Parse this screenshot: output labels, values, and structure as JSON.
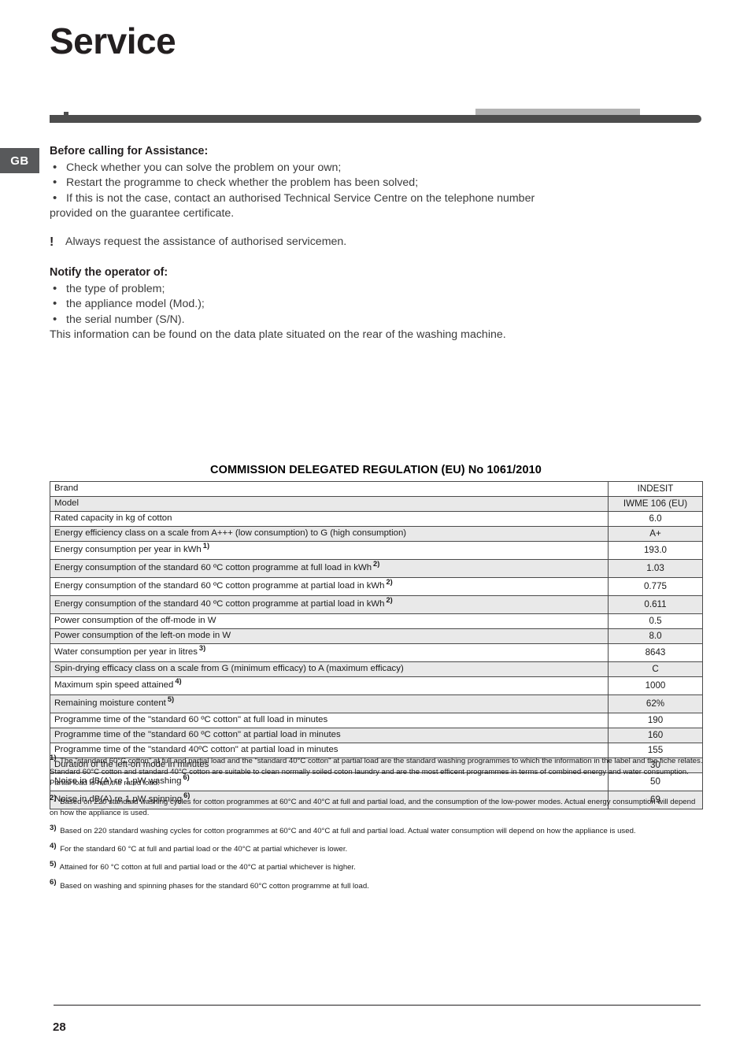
{
  "page": {
    "title": "Service",
    "language_tab": "GB",
    "page_number": "28"
  },
  "assistance": {
    "heading": "Before calling for Assistance:",
    "bullets": [
      "Check whether you can solve the problem on your own;",
      "Restart the programme to check whether the problem has been solved;",
      "If this is not the case, contact an authorised Technical Service Centre on the telephone number"
    ],
    "continuation": "provided on the guarantee certificate."
  },
  "warning": {
    "marker": "!",
    "text": "Always request the assistance of authorised servicemen."
  },
  "notify": {
    "heading": "Notify the operator of:",
    "bullets": [
      "the type of problem;",
      "the appliance model (Mod.);",
      "the serial number (S/N)."
    ],
    "closing": "This information can be found on the data plate situated on the rear of the washing machine."
  },
  "regulation_table": {
    "title": "COMMISSION DELEGATED REGULATION (EU) No 1061/2010",
    "rows": [
      {
        "label": "Brand",
        "footnote": "",
        "value": "INDESIT",
        "shade": false,
        "tall": false
      },
      {
        "label": "Model",
        "footnote": "",
        "value": "IWME 106 (EU)",
        "shade": true,
        "tall": false
      },
      {
        "label": "Rated capacity in kg of cotton",
        "footnote": "",
        "value": "6.0",
        "shade": false,
        "tall": false
      },
      {
        "label": "Energy efficiency class on a scale from A+++ (low consumption) to G (high consumption)",
        "footnote": "",
        "value": "A+",
        "shade": true,
        "tall": false
      },
      {
        "label": "Energy consumption per year in kWh",
        "footnote": "1)",
        "value": "193.0",
        "shade": false,
        "tall": true
      },
      {
        "label": "Energy consumption of the standard 60 ºC cotton programme at full load in kWh",
        "footnote": "2)",
        "value": "1.03",
        "shade": true,
        "tall": true
      },
      {
        "label": "Energy consumption of the standard 60 ºC cotton programme at partial load in kWh",
        "footnote": "2)",
        "value": "0.775",
        "shade": false,
        "tall": true
      },
      {
        "label": "Energy consumption of the standard 40 ºC cotton programme at partial load in kWh",
        "footnote": "2)",
        "value": "0.611",
        "shade": true,
        "tall": true
      },
      {
        "label": "Power consumption of the off-mode in W",
        "footnote": "",
        "value": "0.5",
        "shade": false,
        "tall": false
      },
      {
        "label": "Power consumption of the left-on mode in W",
        "footnote": "",
        "value": "8.0",
        "shade": true,
        "tall": false
      },
      {
        "label": "Water consumption per year in litres",
        "footnote": "3)",
        "value": "8643",
        "shade": false,
        "tall": true
      },
      {
        "label": "Spin-drying efficacy class on a scale from G (minimum efficacy) to A (maximum efficacy)",
        "footnote": "",
        "value": "C",
        "shade": true,
        "tall": false
      },
      {
        "label": "Maximum spin speed attained",
        "footnote": "4)",
        "value": "1000",
        "shade": false,
        "tall": true
      },
      {
        "label": "Remaining moisture content",
        "footnote": "5)",
        "value": "62%",
        "shade": true,
        "tall": true
      },
      {
        "label": "Programme time of the \"standard 60 ºC cotton\" at full load in minutes",
        "footnote": "",
        "value": "190",
        "shade": false,
        "tall": false
      },
      {
        "label": "Programme time of the \"standard 60 ºC cotton\" at partial load in minutes",
        "footnote": "",
        "value": "160",
        "shade": true,
        "tall": false
      },
      {
        "label": "Programme time of the \"standard 40ºC cotton\" at partial load in minutes",
        "footnote": "",
        "value": "155",
        "shade": false,
        "tall": false
      },
      {
        "label": "Duration of the left-on mode in minutes",
        "footnote": "",
        "value": "30",
        "shade": true,
        "tall": false
      },
      {
        "label": "Noise in dB(A) re 1 pW washing",
        "footnote": "6)",
        "value": "50",
        "shade": false,
        "tall": true
      },
      {
        "label": "Noise in dB(A) re 1 pW spinning",
        "footnote": "6)",
        "value": "69",
        "shade": true,
        "tall": true
      }
    ]
  },
  "footnotes": [
    {
      "num": "1)",
      "text": "The \"standard 60°C cotton\" at full and partial load and the \"standard 40°C cotton\" at partial load are the standard washing programmes to which the information in the label and the fiche relates. Standard 60°C cotton and standard 40°C cotton are suitable to clean normally soiled coton laundry and are the most efficent programmes in terms of combined energy and water consumption. Partial load is half the rated load."
    },
    {
      "num": "2)",
      "text": "Based on 220 standard washing cycles for cotton programmes at 60°C and 40°C at full and partial load, and the consumption of the low-power modes. Actual energy consumption will depend on how the appliance is used."
    },
    {
      "num": "3)",
      "text": "Based on 220 standard washing cycles for cotton programmes at 60°C and 40°C at full and partial load. Actual water consumption will depend on how the appliance is used."
    },
    {
      "num": "4)",
      "text": "For the standard 60 °C at full and partial load or the 40°C at partial whichever is lower."
    },
    {
      "num": "5)",
      "text": "Attained for 60 °C cotton at full and partial load or the 40°C at partial whichever is higher."
    },
    {
      "num": "6)",
      "text": "Based on washing and spinning phases for the standard 60°C cotton programme at full load."
    }
  ]
}
